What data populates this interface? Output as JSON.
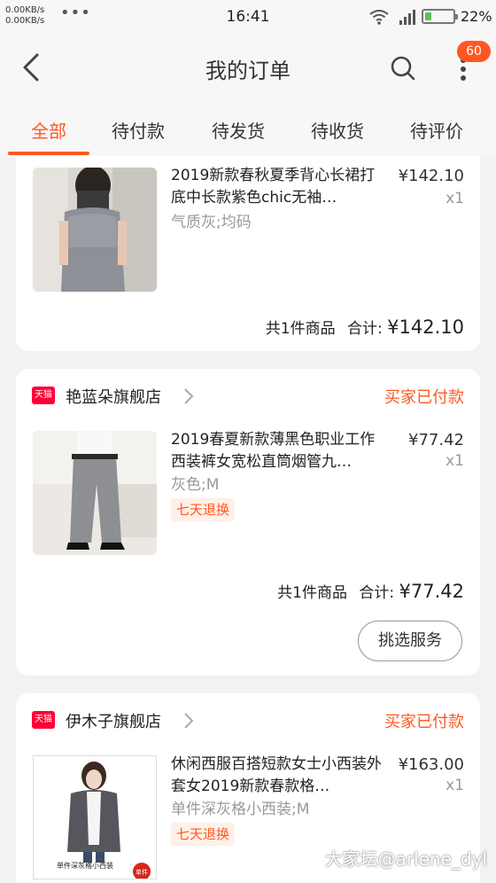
{
  "status_bar": {
    "net_speed_1": "0.00KB/s",
    "net_speed_2": "0.00KB/s",
    "more_dots": "•••",
    "time": "16:41",
    "battery_percent": "22%",
    "battery_level": 0.22
  },
  "header": {
    "title": "我的订单",
    "notification_count": "60"
  },
  "tabs": [
    {
      "label": "全部",
      "active": true
    },
    {
      "label": "待付款",
      "active": false
    },
    {
      "label": "待发货",
      "active": false
    },
    {
      "label": "待收货",
      "active": false
    },
    {
      "label": "待评价",
      "active": false
    }
  ],
  "orders": [
    {
      "product": {
        "title": "2019新款春秋夏季背心长裙打底中长款紫色chic无袖…",
        "price": "¥142.10",
        "qty": "x1",
        "variant": "气质灰;均码"
      },
      "summary": {
        "count_label": "共1件商品",
        "total_label": "合计:",
        "total_amount": "¥142.10"
      }
    },
    {
      "shop": "艳蓝朵旗舰店",
      "status": "买家已付款",
      "product": {
        "title": "2019春夏新款薄黑色职业工作西装裤女宽松直筒烟管九…",
        "price": "¥77.42",
        "qty": "x1",
        "variant": "灰色;M",
        "tag": "七天退换"
      },
      "summary": {
        "count_label": "共1件商品",
        "total_label": "合计:",
        "total_amount": "¥77.42"
      },
      "service_button": "挑选服务"
    },
    {
      "shop": "伊木子旗舰店",
      "status": "买家已付款",
      "product": {
        "title": "休闲西服百搭短款女士小西装外套女2019新款春款格…",
        "price": "¥163.00",
        "qty": "x1",
        "variant": "单件深灰格小西装;M",
        "tag": "七天退换",
        "image_caption": "单件深灰格小西装",
        "image_badge": "单件"
      }
    }
  ],
  "tmall_logo_text": "天猫",
  "watermark": "大家坛@arlene_dyl",
  "colors": {
    "accent": "#ff5722",
    "tmall_red": "#ff0036",
    "battery_green": "#5bbf5b"
  }
}
